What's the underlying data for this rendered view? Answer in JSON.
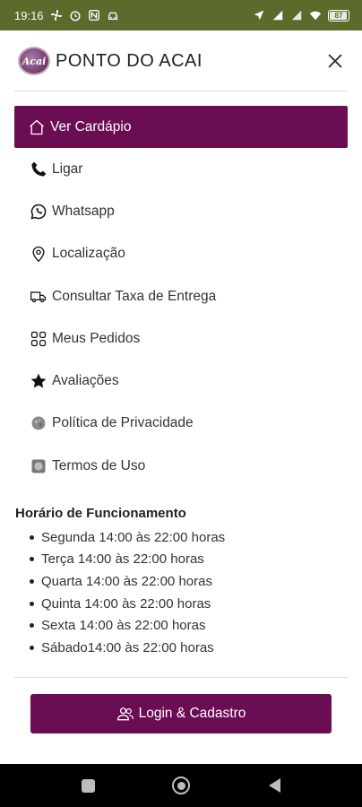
{
  "status_bar": {
    "time": "19:16",
    "battery": "87",
    "icons_left": [
      "fan-icon",
      "alarm-icon",
      "n-badge-icon",
      "car-icon"
    ],
    "icons_right": [
      "location-arrow-icon",
      "signal-icon",
      "signal-icon",
      "wifi-icon"
    ]
  },
  "header": {
    "logo_text": "Acai",
    "title": "PONTO DO ACAI"
  },
  "menu": {
    "items": [
      {
        "label": "Ver Cardápio",
        "icon": "home-icon",
        "active": true
      },
      {
        "label": "Ligar",
        "icon": "phone-icon"
      },
      {
        "label": "Whatsapp",
        "icon": "whatsapp-icon"
      },
      {
        "label": "Localização",
        "icon": "location-pin-icon"
      },
      {
        "label": "Consultar Taxa de Entrega",
        "icon": "truck-icon"
      },
      {
        "label": "Meus Pedidos",
        "icon": "grid-icon"
      },
      {
        "label": "Avaliações",
        "icon": "star-icon"
      },
      {
        "label": "Política de Privacidade",
        "icon": "privacy-image-icon"
      },
      {
        "label": "Termos de Uso",
        "icon": "terms-image-icon"
      }
    ]
  },
  "hours": {
    "title": "Horário de Funcionamento",
    "items": [
      "Segunda 14:00 às 22:00 horas",
      "Terça 14:00 às 22:00 horas",
      "Quarta 14:00 às 22:00 horas",
      "Quinta 14:00 às 22:00 horas",
      "Sexta 14:00 às 22:00 horas",
      "Sábado14:00 às 22:00 horas"
    ]
  },
  "login": {
    "label": "Login & Cadastro",
    "icon": "users-icon"
  },
  "colors": {
    "status_bar": "#5a6b2c",
    "accent": "#6b0d53",
    "nav_bar": "#000000"
  }
}
